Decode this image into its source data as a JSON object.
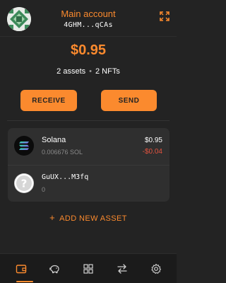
{
  "colors": {
    "accent": "#fb8a2e",
    "background": "#232323",
    "card": "#2f2f2f",
    "negative": "#e5533f"
  },
  "header": {
    "account_name": "Main account",
    "account_address": "4GHM...qCAs",
    "avatar_icon": "identicon",
    "expand_icon": "expand-icon"
  },
  "summary": {
    "balance": "$0.95",
    "assets_count": "2 assets",
    "separator": "•",
    "nfts_count": "2 NFTs"
  },
  "actions": {
    "receive_label": "RECEIVE",
    "send_label": "SEND"
  },
  "assets": [
    {
      "name": "Solana",
      "amount": "0.006676 SOL",
      "value": "$0.95",
      "change": "-$0.04",
      "icon": "solana-logo"
    },
    {
      "name": "GuUX...M3fq",
      "amount": "0",
      "value": "",
      "change": "",
      "icon": "unknown-token-icon"
    }
  ],
  "add_asset": {
    "plus": "+",
    "label": "ADD NEW ASSET"
  },
  "tabbar": {
    "active_index": 0,
    "tabs": [
      {
        "icon": "wallet-icon"
      },
      {
        "icon": "piggy-bank-icon"
      },
      {
        "icon": "grid-icon"
      },
      {
        "icon": "swap-icon"
      },
      {
        "icon": "settings-gear-icon"
      }
    ]
  }
}
